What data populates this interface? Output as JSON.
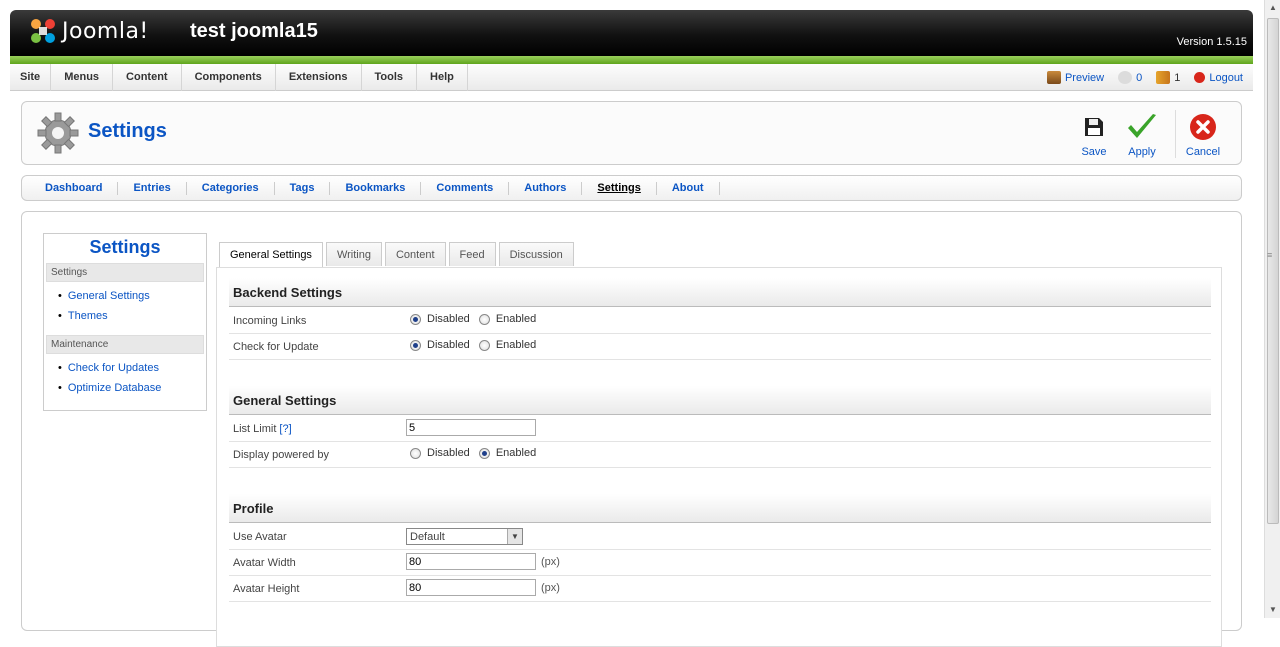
{
  "header": {
    "logo_text": "Joomla!",
    "site_name": "test joomla15",
    "version": "Version 1.5.15"
  },
  "menu": {
    "items": [
      "Site",
      "Menus",
      "Content",
      "Components",
      "Extensions",
      "Tools",
      "Help"
    ]
  },
  "status": {
    "preview": "Preview",
    "messages": "0",
    "users": "1",
    "logout": "Logout"
  },
  "toolbar": {
    "title": "Settings",
    "save": "Save",
    "apply": "Apply",
    "cancel": "Cancel"
  },
  "subnav": {
    "items": [
      "Dashboard",
      "Entries",
      "Categories",
      "Tags",
      "Bookmarks",
      "Comments",
      "Authors",
      "Settings",
      "About"
    ],
    "active": "Settings"
  },
  "sidepanel": {
    "title": "Settings",
    "group1": "Settings",
    "group1_items": [
      "General Settings",
      "Themes"
    ],
    "group2": "Maintenance",
    "group2_items": [
      "Check for Updates",
      "Optimize Database"
    ]
  },
  "tabs": {
    "items": [
      "General Settings",
      "Writing",
      "Content",
      "Feed",
      "Discussion"
    ],
    "active": "General Settings"
  },
  "form": {
    "backend": {
      "title": "Backend Settings",
      "incoming_links": "Incoming Links",
      "check_update": "Check for Update"
    },
    "general": {
      "title": "General Settings",
      "list_limit": "List Limit",
      "list_limit_help": "[?]",
      "list_limit_value": "5",
      "powered_by": "Display powered by"
    },
    "profile": {
      "title": "Profile",
      "use_avatar": "Use Avatar",
      "use_avatar_value": "Default",
      "avatar_width": "Avatar Width",
      "avatar_width_value": "80",
      "avatar_height": "Avatar Height",
      "avatar_height_value": "80",
      "unit": "(px)"
    },
    "opt_disabled": "Disabled",
    "opt_enabled": "Enabled"
  }
}
